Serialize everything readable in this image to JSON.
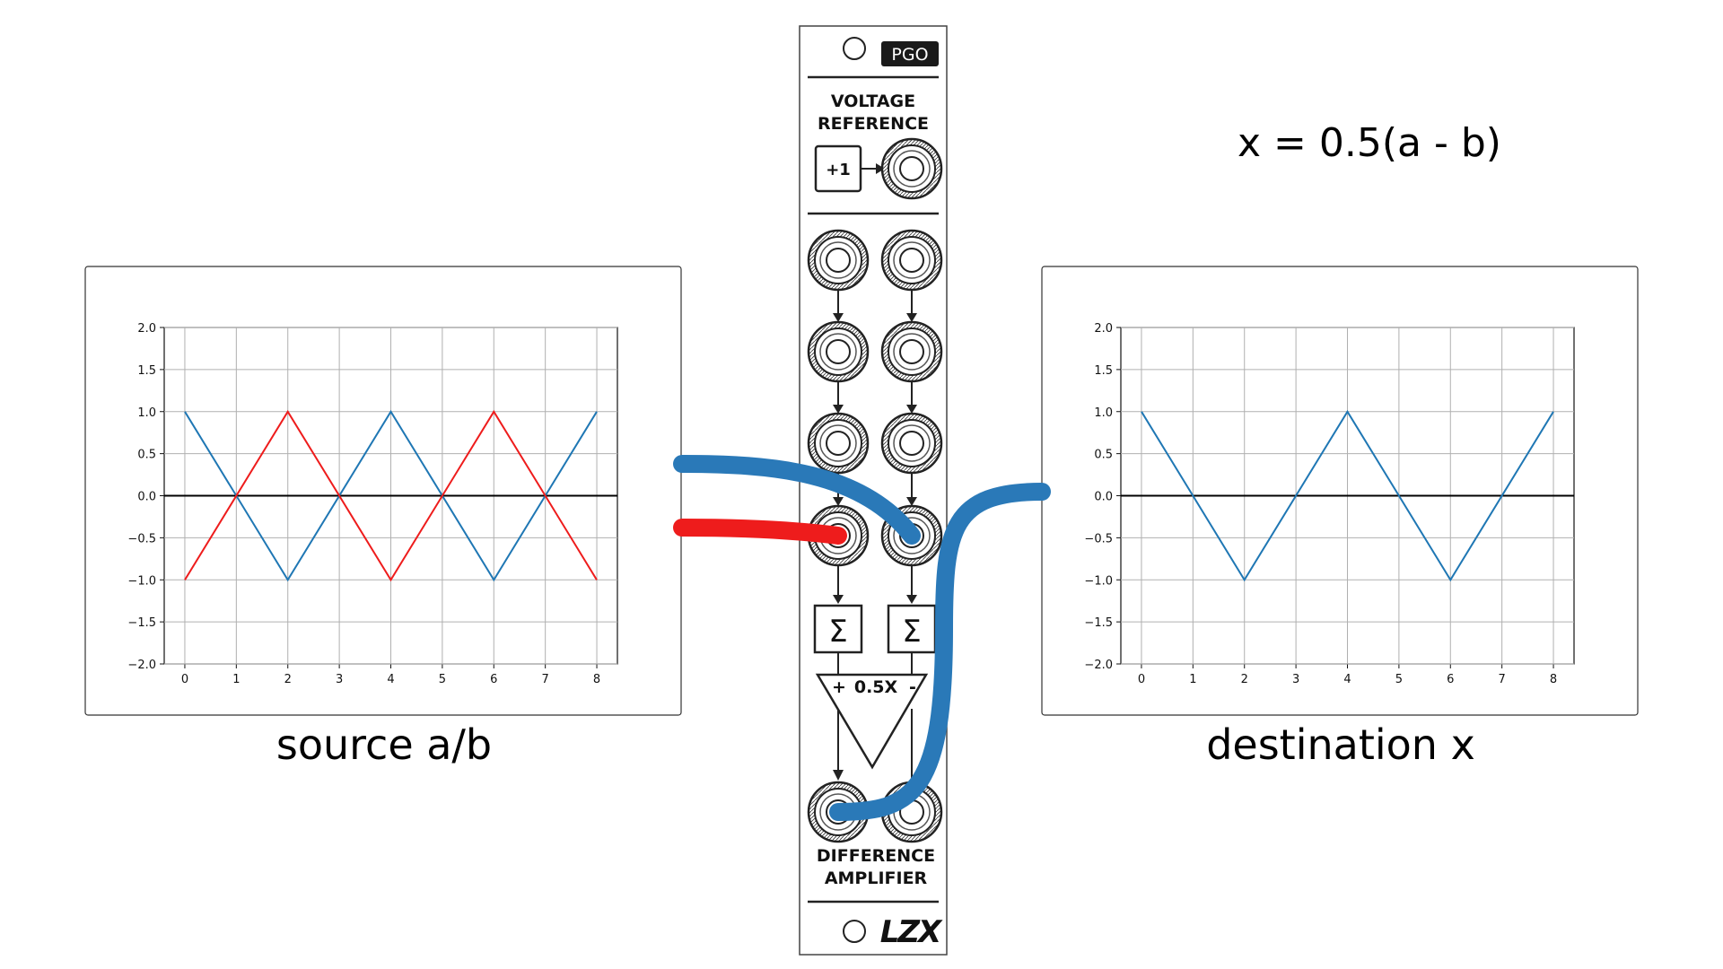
{
  "panel": {
    "badge": "PGO",
    "section_top_line1": "VOLTAGE",
    "section_top_line2": "REFERENCE",
    "ref_button": "+1",
    "sigma": "Σ",
    "amp_plus": "+",
    "amp_gain": "0.5X",
    "amp_minus": "-",
    "section_bottom_line1": "DIFFERENCE",
    "section_bottom_line2": "AMPLIFIER",
    "logo": "LZX"
  },
  "formula": "x = 0.5(a - b)",
  "source_caption": "source a/b",
  "destination_caption": "destination x",
  "colors": {
    "series_a": "#1f77b4",
    "series_b": "#ee1c1c",
    "cable_blue": "#2a79b8",
    "cable_red": "#ee1c1c",
    "panel_stroke": "#222222"
  },
  "chart_data": [
    {
      "type": "line",
      "x_ticks": [
        "0",
        "1",
        "2",
        "3",
        "4",
        "5",
        "6",
        "7",
        "8"
      ],
      "y_ticks": [
        "2.0",
        "1.5",
        "1.0",
        "0.5",
        "0.0",
        "−0.5",
        "−1.0",
        "−1.5",
        "−2.0"
      ],
      "xlim": [
        -0.4,
        8.4
      ],
      "ylim": [
        -2,
        2
      ],
      "grid": true,
      "series": [
        {
          "color": "#1f77b4",
          "x": [
            0,
            2,
            4,
            6,
            8
          ],
          "y": [
            1,
            -1,
            1,
            -1,
            1
          ]
        },
        {
          "color": "#ee1c1c",
          "x": [
            0,
            2,
            4,
            6,
            8
          ],
          "y": [
            -1,
            1,
            -1,
            1,
            -1
          ]
        }
      ]
    },
    {
      "type": "line",
      "x_ticks": [
        "0",
        "1",
        "2",
        "3",
        "4",
        "5",
        "6",
        "7",
        "8"
      ],
      "y_ticks": [
        "2.0",
        "1.5",
        "1.0",
        "0.5",
        "0.0",
        "−0.5",
        "−1.0",
        "−1.5",
        "−2.0"
      ],
      "xlim": [
        -0.4,
        8.4
      ],
      "ylim": [
        -2,
        2
      ],
      "grid": true,
      "series": [
        {
          "color": "#1f77b4",
          "x": [
            0,
            2,
            4,
            6,
            8
          ],
          "y": [
            1,
            -1,
            1,
            -1,
            1
          ]
        }
      ]
    }
  ]
}
